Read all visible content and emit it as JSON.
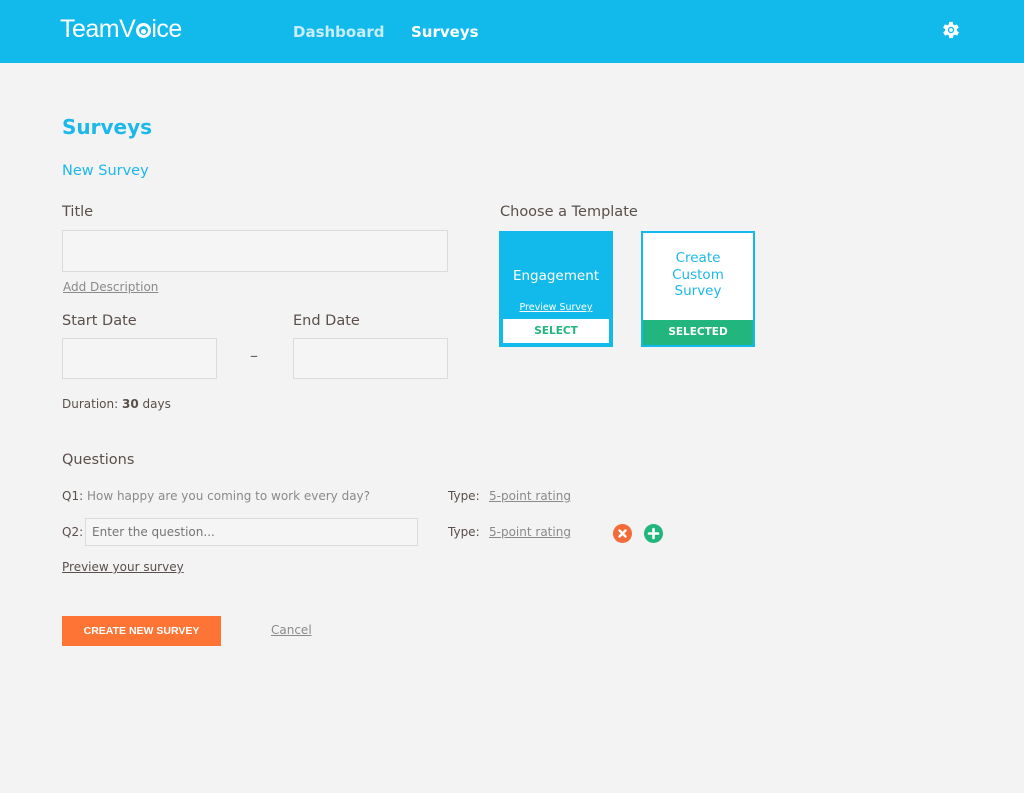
{
  "header": {
    "logo_prefix": "TeamV",
    "logo_suffix": "ice",
    "nav": [
      {
        "label": "Dashboard",
        "active": false
      },
      {
        "label": "Surveys",
        "active": true
      }
    ],
    "settings_icon": "gear-icon"
  },
  "page": {
    "title": "Surveys",
    "subtitle": "New Survey"
  },
  "form": {
    "title_label": "Title",
    "title_value": "",
    "add_description": "Add Description",
    "start_date_label": "Start Date",
    "start_date_value": "",
    "end_date_label": "End Date",
    "end_date_value": "",
    "date_separator": "–",
    "duration_label": "Duration:",
    "duration_value": "30",
    "duration_unit": "days"
  },
  "templates": {
    "heading": "Choose a Template",
    "items": [
      {
        "name": "Engagement",
        "preview_label": "Preview Survey",
        "button_label": "SELECT",
        "selected": false
      },
      {
        "name": "Create Custom Survey",
        "button_label": "SELECTED",
        "selected": true
      }
    ]
  },
  "questions": {
    "heading": "Questions",
    "items": [
      {
        "number": "Q1:",
        "text": "How happy are you coming to work every day?",
        "type_label": "Type:",
        "type_value": "5-point rating"
      },
      {
        "number": "Q2:",
        "placeholder": "Enter the question...",
        "value": "",
        "type_label": "Type:",
        "type_value": "5-point rating"
      }
    ],
    "preview_link": "Preview your survey"
  },
  "actions": {
    "create_label": "CREATE NEW SURVEY",
    "cancel_label": "Cancel"
  },
  "colors": {
    "brand": "#12baec",
    "accent_orange": "#fe7434",
    "success_green": "#22b57d",
    "remove_red": "#f26b3a"
  }
}
